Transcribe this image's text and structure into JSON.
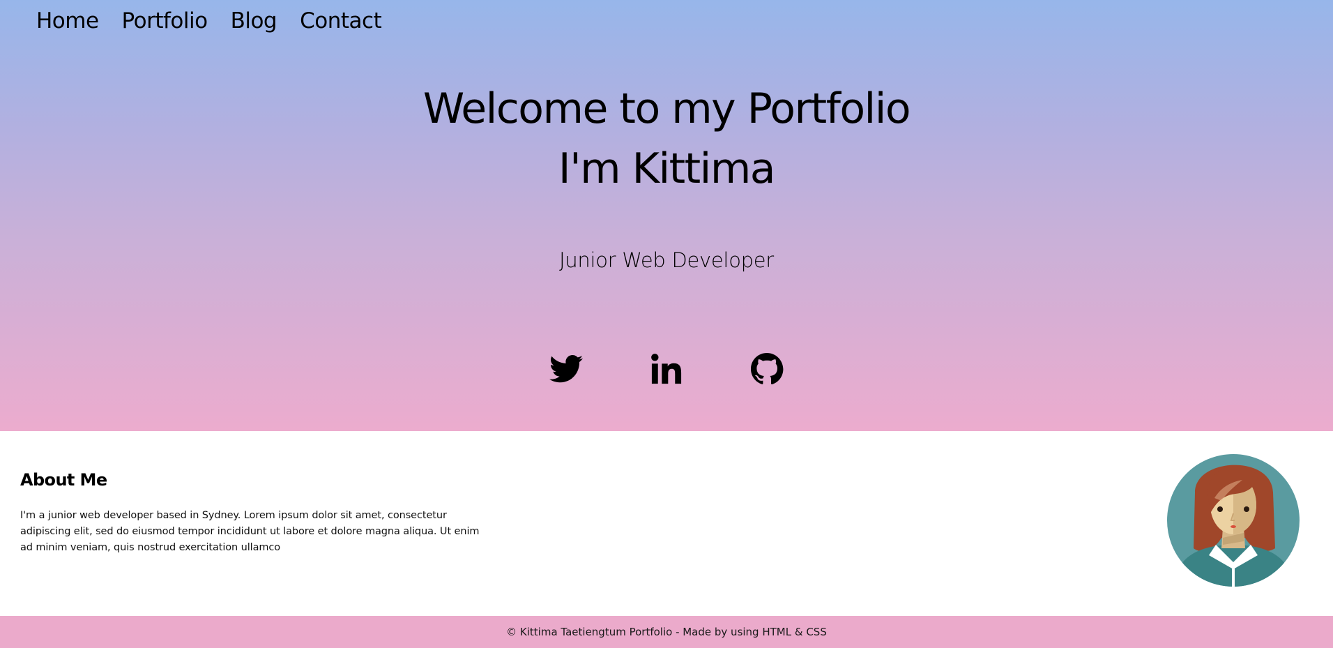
{
  "nav": {
    "items": [
      {
        "label": "Home"
      },
      {
        "label": "Portfolio"
      },
      {
        "label": "Blog"
      },
      {
        "label": "Contact"
      }
    ]
  },
  "hero": {
    "title_line1": "Welcome to my Portfolio",
    "title_line2": "I'm Kittima",
    "subtitle": "Junior Web Developer",
    "social": [
      {
        "icon": "twitter-icon"
      },
      {
        "icon": "linkedin-icon"
      },
      {
        "icon": "github-icon"
      }
    ],
    "gradient_top": "#97b6ea",
    "gradient_bottom": "#ecacce"
  },
  "about": {
    "heading": "About Me",
    "body": "I'm a junior web developer based in Sydney. Lorem ipsum dolor sit amet, consectetur adipiscing elit, sed do eiusmod tempor incididunt ut labore et dolore magna aliqua. Ut enim ad minim veniam, quis nostrud exercitation ullamco"
  },
  "footer": {
    "text": "© Kittima Taetiengtum Portfolio - Made by using HTML & CSS",
    "background": "#ebaacb"
  }
}
